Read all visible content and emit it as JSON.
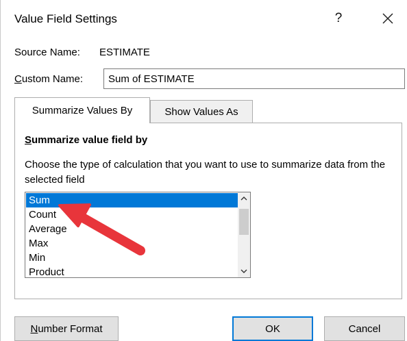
{
  "dialog": {
    "title": "Value Field Settings",
    "help_glyph": "?",
    "source_name_label": "Source Name:",
    "source_name_value": "ESTIMATE",
    "custom_name_label_prefix": "C",
    "custom_name_label_rest": "ustom Name:",
    "custom_name_value": "Sum of ESTIMATE"
  },
  "tabs": [
    {
      "label": "Summarize Values By",
      "active": true
    },
    {
      "label": "Show Values As",
      "active": false
    }
  ],
  "panel": {
    "heading_prefix": "S",
    "heading_rest": "ummarize value field by",
    "instruction": "Choose the type of calculation that you want to use to summarize data from the selected field",
    "calculations": [
      "Sum",
      "Count",
      "Average",
      "Max",
      "Min",
      "Product"
    ],
    "selected": "Sum"
  },
  "buttons": {
    "number_format_prefix": "N",
    "number_format_rest": "umber Format",
    "ok": "OK",
    "cancel": "Cancel"
  },
  "colors": {
    "selection": "#0078d7",
    "annotation_arrow": "#e8353b"
  },
  "icons": {
    "close": "close-icon",
    "scroll_up": "chevron-up-icon",
    "scroll_down": "chevron-down-icon",
    "annotation": "red-arrow-annotation"
  }
}
